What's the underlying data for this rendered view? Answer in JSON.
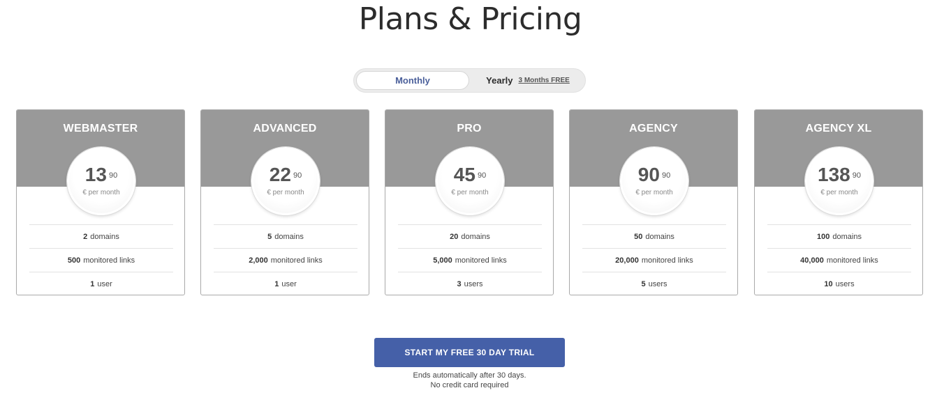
{
  "page": {
    "title": "Plans & Pricing"
  },
  "billing_toggle": {
    "monthly_label": "Monthly",
    "yearly_label": "Yearly",
    "yearly_promo": "3 Months FREE",
    "selected": "Monthly"
  },
  "plans": [
    {
      "name": "WEBMASTER",
      "price": "13",
      "cents": "90",
      "period": "€ per month",
      "features": [
        {
          "value": "2",
          "label": "domains"
        },
        {
          "value": "500",
          "label": "monitored links"
        },
        {
          "value": "1",
          "label": "user"
        }
      ]
    },
    {
      "name": "ADVANCED",
      "price": "22",
      "cents": "90",
      "period": "€ per month",
      "features": [
        {
          "value": "5",
          "label": "domains"
        },
        {
          "value": "2,000",
          "label": "monitored links"
        },
        {
          "value": "1",
          "label": "user"
        }
      ]
    },
    {
      "name": "PRO",
      "price": "45",
      "cents": "90",
      "period": "€ per month",
      "features": [
        {
          "value": "20",
          "label": "domains"
        },
        {
          "value": "5,000",
          "label": "monitored links"
        },
        {
          "value": "3",
          "label": "users"
        }
      ]
    },
    {
      "name": "AGENCY",
      "price": "90",
      "cents": "90",
      "period": "€ per month",
      "features": [
        {
          "value": "50",
          "label": "domains"
        },
        {
          "value": "20,000",
          "label": "monitored links"
        },
        {
          "value": "5",
          "label": "users"
        }
      ]
    },
    {
      "name": "AGENCY XL",
      "price": "138",
      "cents": "90",
      "period": "€ per month",
      "features": [
        {
          "value": "100",
          "label": "domains"
        },
        {
          "value": "40,000",
          "label": "monitored links"
        },
        {
          "value": "10",
          "label": "users"
        }
      ]
    }
  ],
  "cta": {
    "label": "START MY FREE 30 DAY TRIAL",
    "note_line1": "Ends automatically after 30 days.",
    "note_line2": "No credit card required"
  },
  "colors": {
    "cta": "#4560a8",
    "plan_header": "#999999",
    "toggle_active_text": "#4a5f9a"
  }
}
